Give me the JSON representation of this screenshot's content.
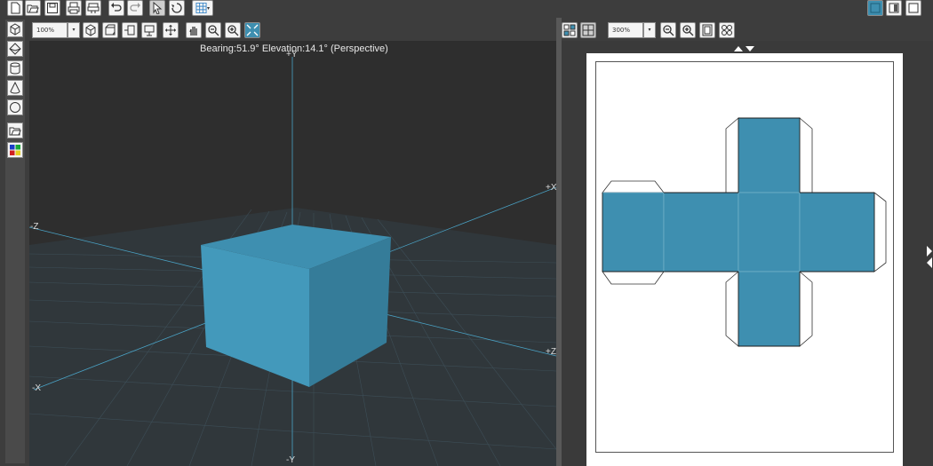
{
  "viewport": {
    "hud_text": "Bearing:51.9° Elevation:14.1° (Perspective)",
    "zoom": "100%",
    "axes": {
      "plus_y": "+Y",
      "minus_y": "-Y",
      "plus_x": "+X",
      "minus_x": "-X",
      "plus_z": "+Z",
      "minus_z": "-Z"
    },
    "model_color": "#3e8fb0"
  },
  "unfold_view": {
    "zoom": "300%",
    "net_fill": "#3e8fb0",
    "page_color": "#ffffff"
  },
  "toolbar": {
    "file_tools": [
      "new-file-icon",
      "open-file-icon",
      "save-icon",
      "print-icon",
      "print-settings-icon"
    ],
    "edit_tools": [
      "undo-icon",
      "redo-icon"
    ],
    "select_tools": [
      "select-arrow-icon",
      "rotate-icon",
      "grid-icon"
    ]
  },
  "view_mode_buttons": [
    "view-3d-only-icon",
    "view-split-icon",
    "view-2d-only-icon"
  ]
}
